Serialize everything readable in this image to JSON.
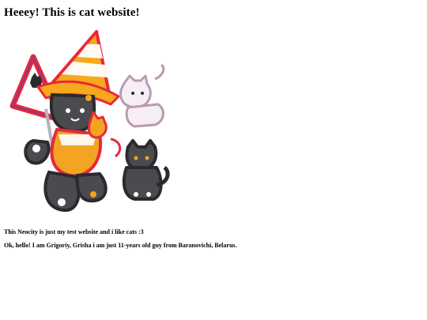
{
  "page": {
    "title": "Heeey! This is cat website!",
    "intro": "This Neocity is just my test website and i like cats :3",
    "about": "Ok, hello! I am Grigoriy, Grisha i am just 11-years old guy from Baranovichi, Belarus."
  },
  "image": {
    "icon": "cats-in-traffic-cone-illustration-icon",
    "colors": {
      "cone_orange": "#f7a81b",
      "cone_white": "#ffffff",
      "sign_red": "#e8293a",
      "sign_purple": "#6c3fa0",
      "cat_dark": "#4b4a4e",
      "cat_outline": "#2b2a2e",
      "cat_pink": "#f7eef5",
      "cat_orange": "#f3a423"
    }
  }
}
